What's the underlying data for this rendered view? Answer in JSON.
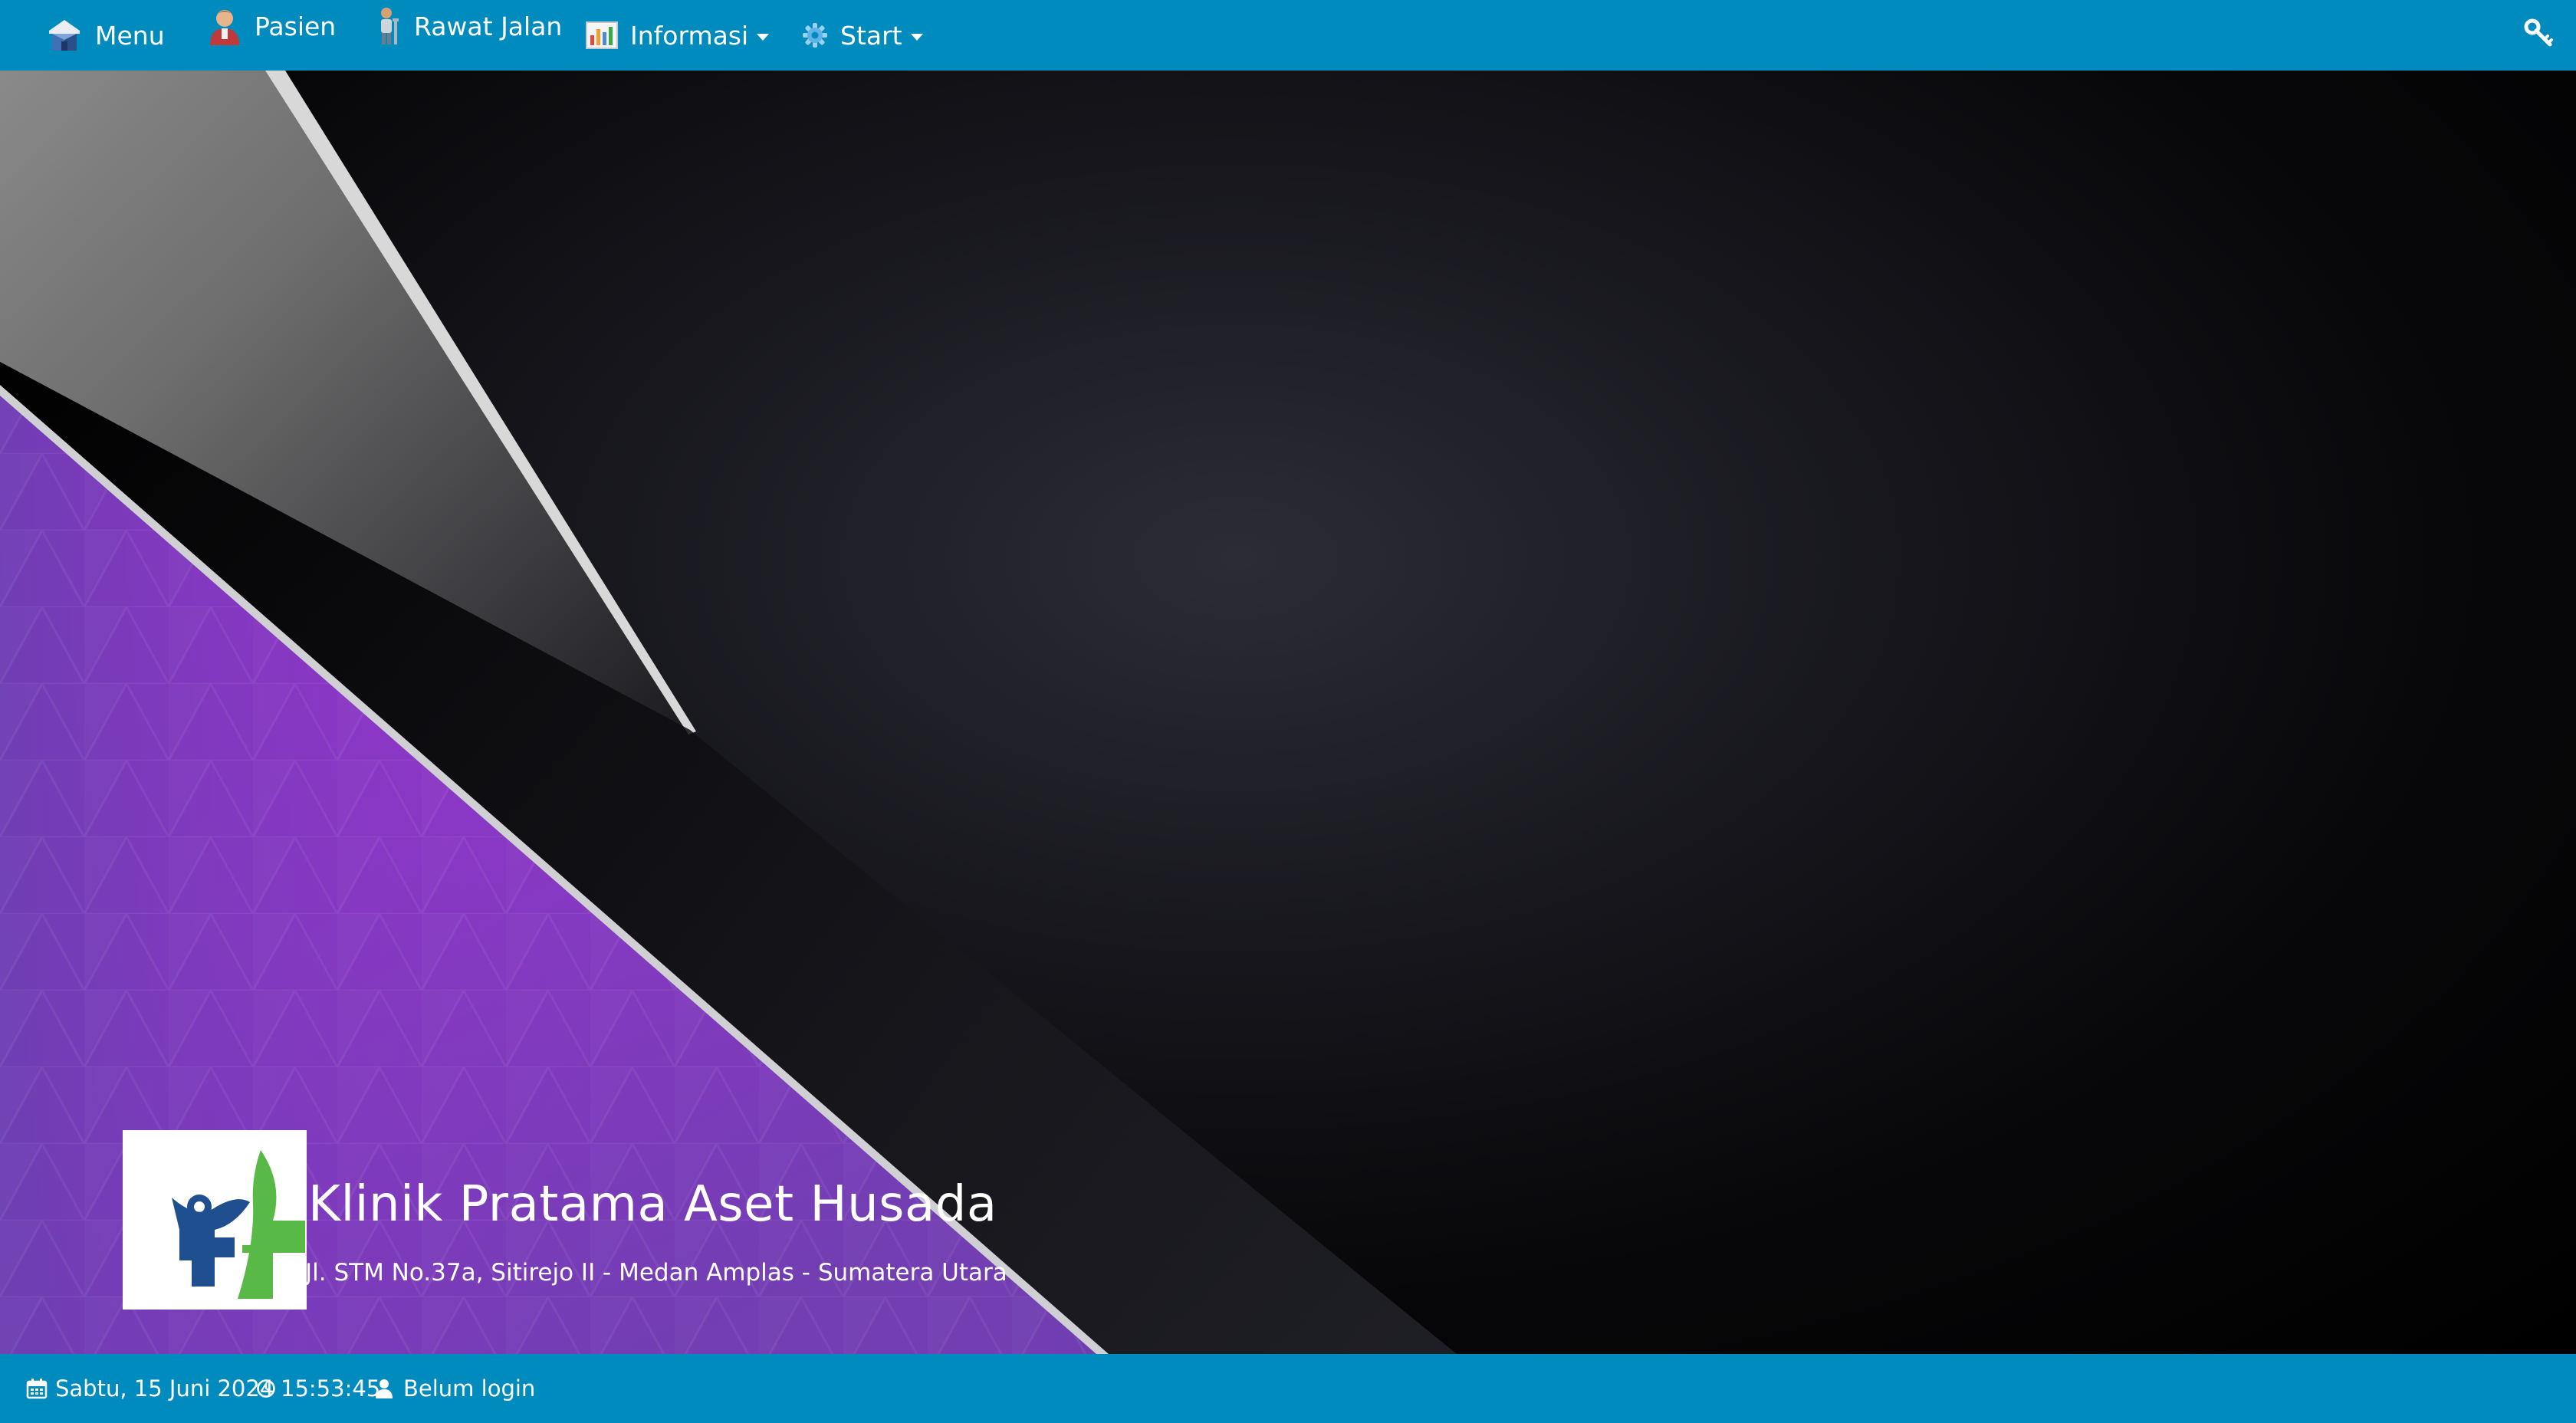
{
  "navbar": {
    "items": [
      {
        "label": "Menu",
        "icon": "house-icon"
      },
      {
        "label": "Pasien",
        "icon": "patient-icon"
      },
      {
        "label": "Rawat Jalan",
        "icon": "outpatient-icon"
      },
      {
        "label": "Informasi",
        "icon": "chart-icon",
        "dropdown": true
      },
      {
        "label": "Start",
        "icon": "gear-icon",
        "dropdown": true
      }
    ],
    "right_icon": "key-icon",
    "color": "#008bbf"
  },
  "hero": {
    "title": "Klinik Pratama Aset Husada",
    "address": "Jl. STM No.37a, Sitirejo II - Medan Amplas - Sumatera Utara",
    "accent_color": "#9b2fc9"
  },
  "footer": {
    "date": "Sabtu, 15 Juni 2024",
    "time": "15:53:45",
    "user_status": "Belum login"
  }
}
